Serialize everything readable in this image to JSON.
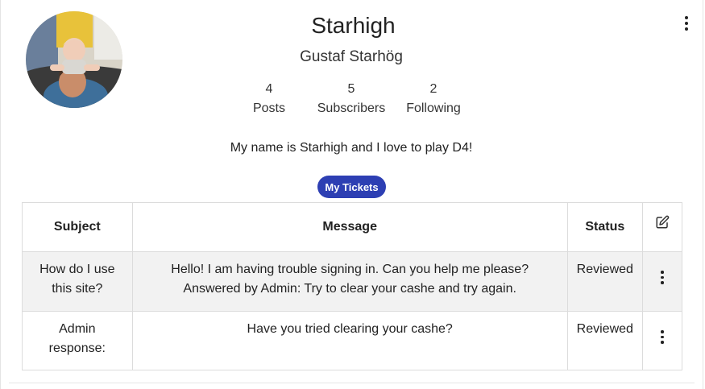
{
  "profile": {
    "handle": "Starhigh",
    "full_name": "Gustaf Starhög",
    "bio": "My name is Starhigh and I love to play D4!",
    "stats": [
      {
        "count": "4",
        "label": "Posts"
      },
      {
        "count": "5",
        "label": "Subscribers"
      },
      {
        "count": "2",
        "label": "Following"
      }
    ],
    "menu_icon": "more-vertical-icon"
  },
  "tickets_button": {
    "label": "My Tickets",
    "color": "#2d3fb3"
  },
  "table": {
    "headers": {
      "subject": "Subject",
      "message": "Message",
      "status": "Status",
      "action_icon": "edit-icon"
    },
    "rows": [
      {
        "subject": "How do I use this site?",
        "message_line1": "Hello! I am having trouble signing in. Can you help me please?",
        "message_line2": "Answered by Admin: Try to clear your cashe and try again.",
        "status": "Reviewed",
        "menu_icon": "more-vertical-icon"
      },
      {
        "subject": "Admin response:",
        "message_line1": "Have you tried clearing your cashe?",
        "message_line2": "",
        "status": "Reviewed",
        "menu_icon": "more-vertical-icon"
      }
    ]
  }
}
